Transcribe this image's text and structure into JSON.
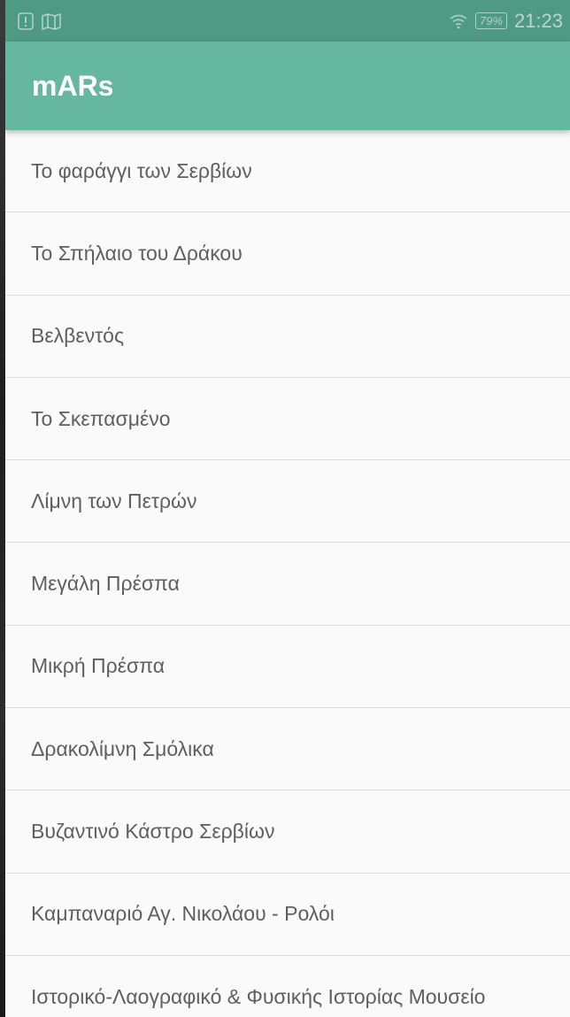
{
  "status_bar": {
    "left_icons": [
      "alert-icon",
      "map-icon"
    ],
    "battery_percent": "79%",
    "time": "21:23"
  },
  "app_bar": {
    "title": "mARs"
  },
  "colors": {
    "status_bar": "#4f9a85",
    "app_bar": "#65b89e",
    "list_background": "#fafafa",
    "list_text": "#5f5f5f",
    "divider": "#dcdcdc"
  },
  "list": {
    "items": [
      {
        "label": "Το φαράγγι των Σερβίων"
      },
      {
        "label": "Το Σπήλαιο του Δράκου"
      },
      {
        "label": "Βελβεντός"
      },
      {
        "label": "Το Σκεπασμένο"
      },
      {
        "label": "Λίμνη των Πετρών"
      },
      {
        "label": "Μεγάλη Πρέσπα"
      },
      {
        "label": "Μικρή Πρέσπα"
      },
      {
        "label": "Δρακολίμνη Σμόλικα"
      },
      {
        "label": "Βυζαντινό Κάστρο Σερβίων"
      },
      {
        "label": "Καμπαναριό Αγ. Νικολάου - Ρολόι"
      },
      {
        "label": "Ιστορικό-Λαογραφικό & Φυσικής Ιστορίας Μουσείο"
      }
    ]
  }
}
